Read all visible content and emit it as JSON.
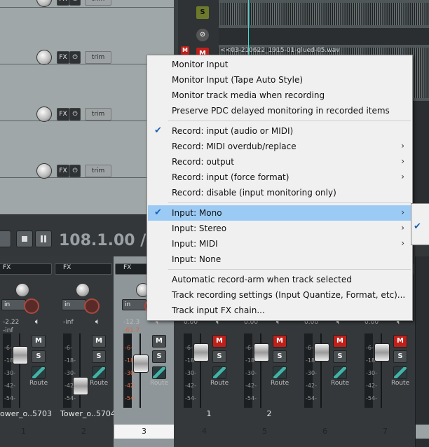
{
  "tcp": {
    "tracks": [
      {
        "fx": "FX",
        "trim": "trim"
      },
      {
        "fx": "FX",
        "trim": "trim"
      },
      {
        "fx": "FX",
        "trim": "trim"
      },
      {
        "fx": "FX",
        "trim": "trim"
      }
    ],
    "solo": "S",
    "mute": "M",
    "item_label": "<<03-210622_1915-01-glued-05.wav"
  },
  "transport": {
    "time": "108.1.00 / 3"
  },
  "colors": {
    "menu_highlight": "#9bcbf5",
    "check": "#1a5fb4",
    "mute_red": "#c0201a",
    "solo_green": "#5e7a2c"
  },
  "menu": {
    "items": [
      {
        "label": "Monitor Input",
        "checked": false,
        "submenu": false
      },
      {
        "label": "Monitor Input (Tape Auto Style)",
        "checked": false,
        "submenu": false
      },
      {
        "label": "Monitor track media when recording",
        "checked": false,
        "submenu": false
      },
      {
        "label": "Preserve PDC delayed monitoring in recorded items",
        "checked": false,
        "submenu": false
      },
      {
        "label": "Record: input (audio or MIDI)",
        "checked": true,
        "submenu": false
      },
      {
        "label": "Record: MIDI overdub/replace",
        "checked": false,
        "submenu": true
      },
      {
        "label": "Record: output",
        "checked": false,
        "submenu": true
      },
      {
        "label": "Record: input (force format)",
        "checked": false,
        "submenu": true
      },
      {
        "label": "Record: disable (input monitoring only)",
        "checked": false,
        "submenu": false
      },
      {
        "label": "Input: Mono",
        "checked": true,
        "submenu": true,
        "highlighted": true
      },
      {
        "label": "Input: Stereo",
        "checked": false,
        "submenu": true
      },
      {
        "label": "Input: MIDI",
        "checked": false,
        "submenu": true
      },
      {
        "label": "Input: None",
        "checked": false,
        "submenu": false
      },
      {
        "label": "Automatic record-arm when track selected",
        "checked": false,
        "submenu": false
      },
      {
        "label": "Track recording settings (Input Quantize, Format, etc)...",
        "checked": false,
        "submenu": false
      },
      {
        "label": "Track input FX chain...",
        "checked": false,
        "submenu": false
      }
    ]
  },
  "mixer": {
    "fx_label": "FX",
    "in_label": "in",
    "route_label": "Route",
    "solo": "S",
    "mute": "M",
    "scale": [
      "-6-",
      "-18-",
      "-30-",
      "-42-",
      "-54-"
    ],
    "strips": [
      {
        "number": "1",
        "name": "ower_o..5703",
        "volume": "-2.22",
        "peak": "-inf",
        "selected": false
      },
      {
        "number": "2",
        "name": "Tower_o..5704",
        "volume": "-inf",
        "peak": "",
        "selected": false
      },
      {
        "number": "3",
        "name": "",
        "volume": "-12.3",
        "peak": "-61.7",
        "selected": true
      },
      {
        "number": "4",
        "name": "1",
        "volume": "0.00",
        "peak": "",
        "selected": false
      },
      {
        "number": "5",
        "name": "2",
        "volume": "0.00",
        "peak": "",
        "selected": false
      },
      {
        "number": "6",
        "name": "",
        "volume": "0.00",
        "peak": "",
        "selected": false
      },
      {
        "number": "7",
        "name": "",
        "volume": "0.00",
        "peak": "",
        "selected": false
      }
    ]
  }
}
